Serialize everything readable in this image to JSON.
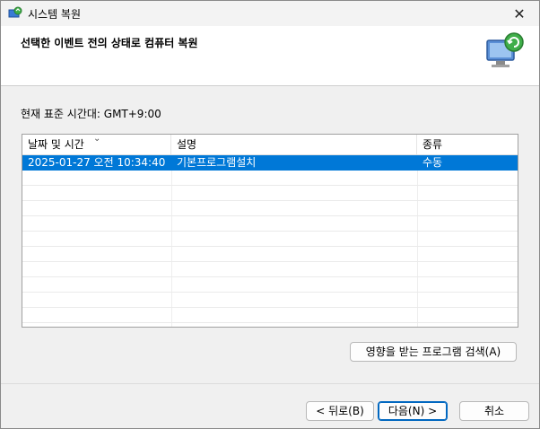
{
  "window": {
    "title": "시스템 복원",
    "close_glyph": "✕"
  },
  "header": {
    "heading": "선택한 이벤트 전의 상태로 컴퓨터 복원"
  },
  "timezone_label": "현재 표준 시간대: GMT+9:00",
  "table": {
    "columns": [
      "날짜 및 시간",
      "설명",
      "종류"
    ],
    "sort_glyph": "⌄",
    "rows": [
      {
        "datetime": "2025-01-27 오전 10:34:40",
        "description": "기본프로그램설치",
        "type": "수동",
        "selected": true
      }
    ]
  },
  "buttons": {
    "scan": "영향을 받는 프로그램 검색(A)",
    "back": "< 뒤로(B)",
    "next": "다음(N) >",
    "cancel": "취소"
  },
  "colors": {
    "selection": "#0078d7",
    "primary_border": "#0067c0"
  },
  "icons": {
    "app": "system-restore-icon",
    "header": "computer-restore-icon"
  }
}
